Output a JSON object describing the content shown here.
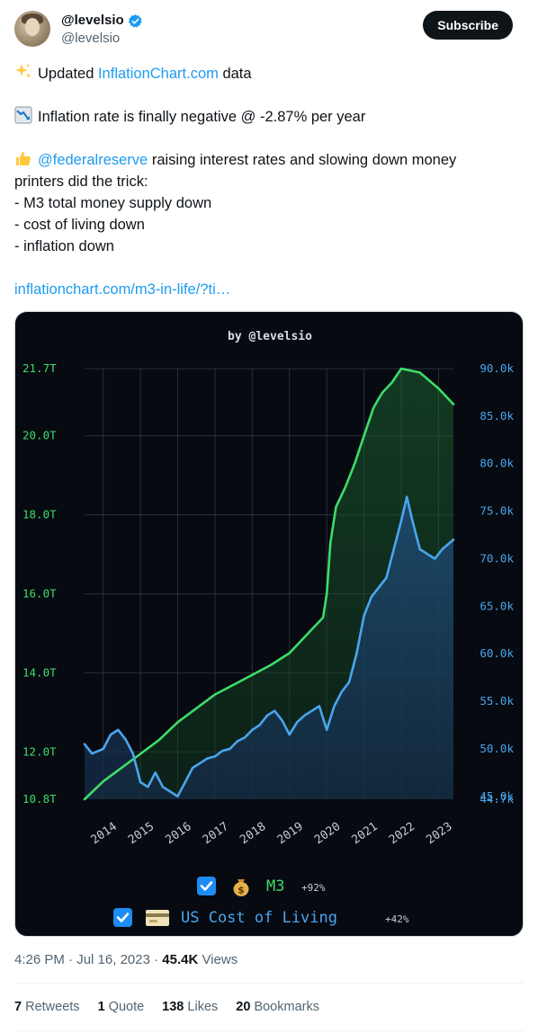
{
  "author": {
    "display_name": "@levelsio",
    "handle": "@levelsio",
    "verified": true,
    "subscribe_label": "Subscribe"
  },
  "tweet": {
    "line1_pre": "Updated ",
    "line1_link": "InflationChart.com",
    "line1_post": " data",
    "line2": "Inflation rate is finally negative @ -2.87% per year",
    "line3_link": "@federalreserve",
    "line3_post": " raising interest rates and slowing down money",
    "line4": "printers did the trick:",
    "line5": "- M3 total money supply down",
    "line6": "- cost of living down",
    "line7": "- inflation down",
    "url": "inflationchart.com/m3-in-life/?ti…"
  },
  "chart_data": {
    "type": "area",
    "title": "by @levelsio",
    "x": [
      "2014",
      "2015",
      "2016",
      "2017",
      "2018",
      "2019",
      "2020",
      "2021",
      "2022",
      "2023"
    ],
    "left_axis": {
      "ticks": [
        "21.7T",
        "20.0T",
        "18.0T",
        "16.0T",
        "14.0T",
        "12.0T",
        "10.8T"
      ],
      "ylim": [
        10.8,
        21.7
      ]
    },
    "right_axis": {
      "ticks": [
        "90.0k",
        "85.0k",
        "80.0k",
        "75.0k",
        "70.0k",
        "65.0k",
        "60.0k",
        "55.0k",
        "50.0k",
        "45.0k",
        "44.7k"
      ],
      "ylim": [
        44.7,
        90.0
      ]
    },
    "grid": true,
    "series": [
      {
        "name": "M3",
        "change": "+92%",
        "color": "#3ddc6a",
        "axis": "left",
        "x": [
          2013.5,
          2014.0,
          2014.5,
          2015.0,
          2015.5,
          2016.0,
          2016.5,
          2017.0,
          2017.5,
          2018.0,
          2018.5,
          2019.0,
          2019.5,
          2019.9,
          2020.0,
          2020.1,
          2020.25,
          2020.5,
          2020.75,
          2021.0,
          2021.25,
          2021.4,
          2021.5,
          2021.75,
          2022.0,
          2022.25,
          2022.5,
          2022.75,
          2023.0,
          2023.4
        ],
        "y": [
          10.8,
          11.25,
          11.6,
          11.95,
          12.3,
          12.75,
          13.1,
          13.45,
          13.7,
          13.95,
          14.2,
          14.5,
          15.0,
          15.4,
          16.0,
          17.3,
          18.2,
          18.7,
          19.3,
          20.0,
          20.7,
          20.95,
          21.1,
          21.35,
          21.7,
          21.65,
          21.6,
          21.4,
          21.2,
          20.8
        ]
      },
      {
        "name": "US Cost of Living",
        "change": "+42%",
        "color": "#49a6ee",
        "axis": "right",
        "x": [
          2013.5,
          2013.7,
          2014.0,
          2014.2,
          2014.4,
          2014.6,
          2014.8,
          2015.0,
          2015.2,
          2015.4,
          2015.6,
          2015.8,
          2016.0,
          2016.2,
          2016.4,
          2016.6,
          2016.8,
          2017.0,
          2017.2,
          2017.4,
          2017.6,
          2017.8,
          2018.0,
          2018.2,
          2018.4,
          2018.6,
          2018.8,
          2019.0,
          2019.2,
          2019.4,
          2019.6,
          2019.8,
          2020.0,
          2020.2,
          2020.4,
          2020.6,
          2020.8,
          2021.0,
          2021.2,
          2021.4,
          2021.6,
          2021.8,
          2022.0,
          2022.15,
          2022.3,
          2022.5,
          2022.7,
          2022.9,
          2023.1,
          2023.4
        ],
        "y": [
          50.5,
          49.5,
          50.0,
          51.5,
          52.0,
          51.0,
          49.5,
          46.5,
          46.0,
          47.5,
          46.0,
          45.5,
          45.0,
          46.5,
          48.0,
          48.5,
          49.0,
          49.2,
          49.8,
          50.0,
          50.8,
          51.2,
          52.0,
          52.5,
          53.5,
          54.0,
          53.0,
          51.5,
          52.8,
          53.5,
          54.0,
          54.5,
          52.0,
          54.5,
          56.0,
          57.0,
          60.0,
          64.0,
          66.0,
          67.0,
          68.0,
          71.0,
          74.0,
          76.5,
          74.0,
          71.0,
          70.5,
          70.0,
          71.0,
          72.0
        ]
      }
    ]
  },
  "legend": {
    "m3_label": "M3",
    "m3_change": "+92%",
    "col_label": "US Cost of Living",
    "col_change": "+42%"
  },
  "meta": {
    "time": "4:26 PM",
    "date": "Jul 16, 2023",
    "views": "45.4K",
    "views_label": "Views"
  },
  "stats": {
    "retweets": "7",
    "retweets_label": "Retweets",
    "quotes": "1",
    "quotes_label": "Quote",
    "likes": "138",
    "likes_label": "Likes",
    "bookmarks": "20",
    "bookmarks_label": "Bookmarks"
  },
  "colors": {
    "accent": "#1d9bf0",
    "m3_green": "#3ddc6a",
    "col_blue": "#49a6ee",
    "chart_bg": "#070a11"
  }
}
